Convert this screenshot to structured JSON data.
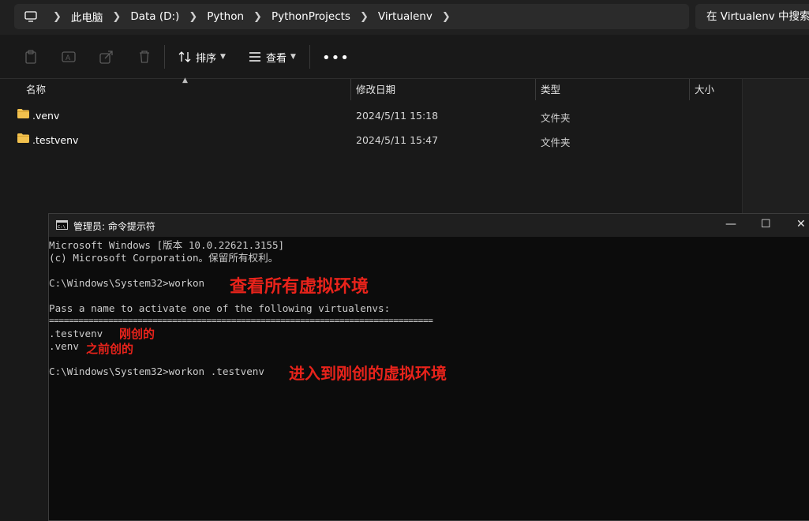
{
  "explorer": {
    "breadcrumb": [
      "此电脑",
      "Data (D:)",
      "Python",
      "PythonProjects",
      "Virtualenv"
    ],
    "search_placeholder": "在 Virtualenv 中搜索",
    "toolbar": {
      "sort_label": "排序",
      "view_label": "查看",
      "more_label": "•••"
    },
    "columns": {
      "name": "名称",
      "modified": "修改日期",
      "type": "类型",
      "size": "大小"
    },
    "files": [
      {
        "name": ".venv",
        "modified": "2024/5/11 15:18",
        "type": "文件夹"
      },
      {
        "name": ".testvenv",
        "modified": "2024/5/11 15:47",
        "type": "文件夹"
      }
    ]
  },
  "cmd": {
    "title": "管理员: 命令提示符",
    "lines": [
      "Microsoft Windows [版本 10.0.22621.3155]",
      "(c) Microsoft Corporation。保留所有权利。",
      "",
      "C:\\Windows\\System32>workon",
      "",
      "Pass a name to activate one of the following virtualenvs:",
      "==============================================================================",
      ".testvenv",
      ".venv",
      "",
      "C:\\Windows\\System32>workon .testvenv"
    ],
    "annotations": {
      "view_all": "查看所有虚拟环境",
      "just_created": "刚创的",
      "created_before": "之前创的",
      "enter_env": "进入到刚创的虚拟环境"
    }
  },
  "colors": {
    "annotation": "#e8231b",
    "folder": "#f2c14e",
    "terminal_bg": "#0c0c0c"
  }
}
